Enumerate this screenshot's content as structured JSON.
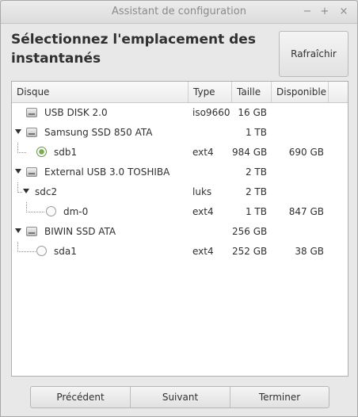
{
  "window": {
    "title": "Assistant de configuration"
  },
  "heading": "Sélectionnez l'emplacement des instantanés",
  "refresh_label": "Rafraîchir",
  "columns": [
    "Disque",
    "Type",
    "Taille",
    "Disponible"
  ],
  "rows": [
    {
      "name": "USB DISK 2.0",
      "type": "iso9660",
      "size": "16 GB",
      "free": ""
    },
    {
      "name": "Samsung SSD 850 ATA",
      "type": "",
      "size": "1 TB",
      "free": ""
    },
    {
      "name": "sdb1",
      "type": "ext4",
      "size": "984 GB",
      "free": "690 GB"
    },
    {
      "name": "External USB 3.0 TOSHIBA",
      "type": "",
      "size": "2 TB",
      "free": ""
    },
    {
      "name": "sdc2",
      "type": "luks",
      "size": "2 TB",
      "free": ""
    },
    {
      "name": "dm-0",
      "type": "ext4",
      "size": "1 TB",
      "free": "847 GB"
    },
    {
      "name": "BIWIN SSD ATA",
      "type": "",
      "size": "256 GB",
      "free": ""
    },
    {
      "name": "sda1",
      "type": "ext4",
      "size": "252 GB",
      "free": "38 GB"
    }
  ],
  "buttons": {
    "previous": "Précédent",
    "next": "Suivant",
    "finish": "Terminer"
  }
}
